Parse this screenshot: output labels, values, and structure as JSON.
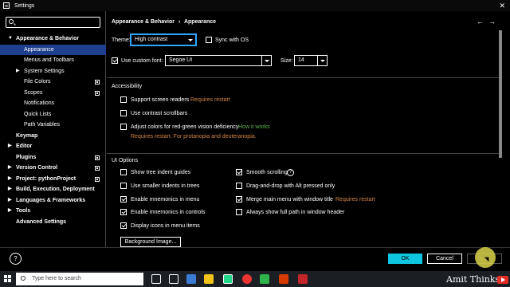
{
  "window": {
    "title": "Settings"
  },
  "search": {
    "placeholder": ""
  },
  "sidebar": {
    "items": [
      {
        "label": "Appearance & Behavior",
        "bold": true,
        "arrow": "down"
      },
      {
        "label": "Appearance",
        "selected": true
      },
      {
        "label": "Menus and Toolbars"
      },
      {
        "label": "System Settings",
        "arrow": "right"
      },
      {
        "label": "File Colors",
        "badge": true
      },
      {
        "label": "Scopes",
        "badge": true
      },
      {
        "label": "Notifications"
      },
      {
        "label": "Quick Lists"
      },
      {
        "label": "Path Variables"
      },
      {
        "label": "Keymap",
        "bold": true
      },
      {
        "label": "Editor",
        "bold": true,
        "arrow": "right"
      },
      {
        "label": "Plugins",
        "bold": true,
        "badge": true
      },
      {
        "label": "Version Control",
        "bold": true,
        "arrow": "right",
        "badge": true
      },
      {
        "label": "Project: pythonProject",
        "bold": true,
        "arrow": "right",
        "badge": true
      },
      {
        "label": "Build, Execution, Deployment",
        "bold": true,
        "arrow": "right"
      },
      {
        "label": "Languages & Frameworks",
        "bold": true,
        "arrow": "right"
      },
      {
        "label": "Tools",
        "bold": true,
        "arrow": "right"
      },
      {
        "label": "Advanced Settings",
        "bold": true
      }
    ]
  },
  "breadcrumb": {
    "parent": "Appearance & Behavior",
    "separator": "›",
    "current": "Appearance"
  },
  "nav": {
    "back": "←",
    "forward": "→"
  },
  "theme": {
    "label": "Theme:",
    "value": "High contrast",
    "sync_label": "Sync with OS",
    "sync_checked": false
  },
  "font": {
    "use_custom_label": "Use custom font:",
    "use_custom_checked": true,
    "value": "Segoe UI",
    "size_label": "Size:",
    "size_value": "14"
  },
  "accessibility": {
    "heading": "Accessibility",
    "screen_readers_label": "Support screen readers",
    "screen_readers_note": "Requires restart",
    "contrast_scrollbars_label": "Use contrast scrollbars",
    "color_adjust_label": "Adjust colors for red-green vision deficiency",
    "color_adjust_link": "How it works",
    "color_adjust_note": "Requires restart. For protanopia and deuteranopia."
  },
  "ui_options": {
    "heading": "UI Options",
    "left": [
      {
        "label": "Show tree indent guides",
        "checked": false
      },
      {
        "label": "Use smaller indents in trees",
        "checked": false
      },
      {
        "label": "Enable mnemonics in menu",
        "checked": true
      },
      {
        "label": "Enable mnemonics in controls",
        "checked": true
      },
      {
        "label": "Display icons in menu items",
        "checked": true
      }
    ],
    "right": [
      {
        "label": "Smooth scrolling",
        "checked": true,
        "help": "?"
      },
      {
        "label": "Drag-and-drop with Alt pressed only",
        "checked": false
      },
      {
        "label": "Merge main menu with window title",
        "checked": true,
        "note": "Requires restart"
      },
      {
        "label": "Always show full path in window header",
        "checked": false
      }
    ],
    "background_button": "Background Image..."
  },
  "footer": {
    "help": "?",
    "ok": "OK",
    "cancel": "Cancel",
    "apply": "Apply"
  },
  "taskbar": {
    "search_placeholder": "Type here to search"
  },
  "watermark": {
    "text": "Amit Thinks"
  },
  "colors": {
    "accent": "#1e3f8e",
    "focus": "#2ea8ff",
    "ok_button": "#0fc6e0",
    "warning": "#d28445",
    "link": "#5fb54f"
  }
}
